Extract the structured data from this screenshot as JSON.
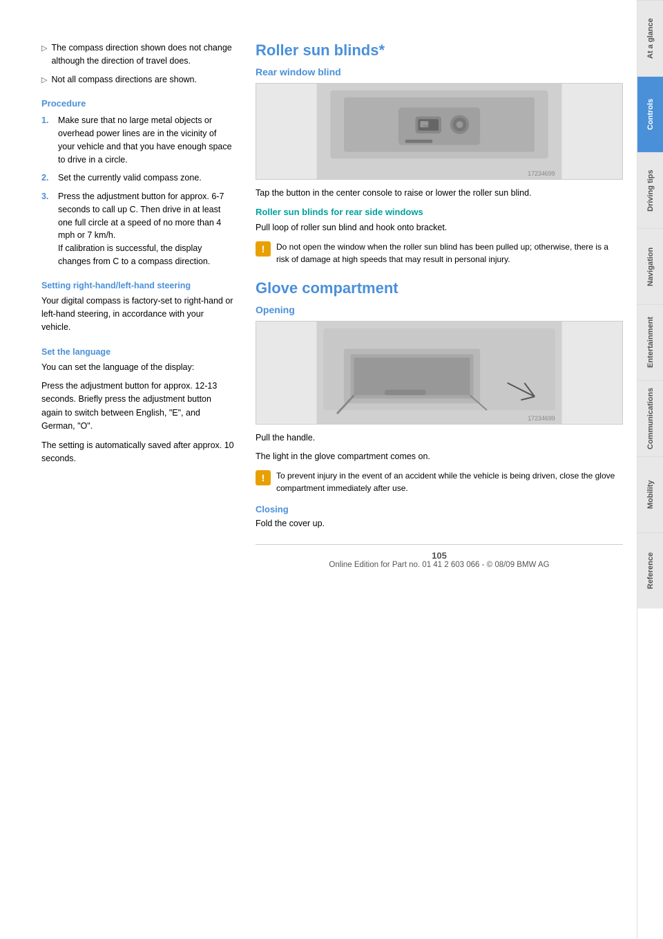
{
  "sidebar": {
    "tabs": [
      {
        "label": "At a glance",
        "active": false
      },
      {
        "label": "Controls",
        "active": true
      },
      {
        "label": "Driving tips",
        "active": false
      },
      {
        "label": "Navigation",
        "active": false
      },
      {
        "label": "Entertainment",
        "active": false
      },
      {
        "label": "Communications",
        "active": false
      },
      {
        "label": "Mobility",
        "active": false
      },
      {
        "label": "Reference",
        "active": false
      }
    ]
  },
  "left_column": {
    "bullets": [
      "The compass direction shown does not change although the direction of travel does.",
      "Not all compass directions are shown."
    ],
    "procedure_heading": "Procedure",
    "procedure_steps": [
      "Make sure that no large metal objects or overhead power lines are in the vicinity of your vehicle and that you have enough space to drive in a circle.",
      "Set the currently valid compass zone.",
      "Press the adjustment button for approx. 6-7 seconds to call up C. Then drive in at least one full circle at a speed of no more than 4 mph or 7 km/h.\nIf calibration is successful, the display changes from C to a compass direction."
    ],
    "setting_heading": "Setting right-hand/left-hand steering",
    "setting_text": "Your digital compass is factory-set to right-hand or left-hand steering, in accordance with your vehicle.",
    "language_heading": "Set the language",
    "language_text1": "You can set the language of the display:",
    "language_text2": "Press the adjustment button for approx. 12-13 seconds. Briefly press the adjustment button again to switch between English, \"E\", and German, \"O\".",
    "language_text3": "The setting is automatically saved after approx. 10 seconds."
  },
  "right_column": {
    "roller_title": "Roller sun blinds*",
    "rear_window_subtitle": "Rear window blind",
    "rear_window_desc": "Tap the button in the center console to raise or lower the roller sun blind.",
    "roller_side_subtitle": "Roller sun blinds for rear side windows",
    "roller_side_desc": "Pull loop of roller sun blind and hook onto bracket.",
    "roller_warning": "Do not open the window when the roller sun blind has been pulled up; otherwise, there is a risk of damage at high speeds that may result in personal injury.",
    "glove_title": "Glove compartment",
    "opening_subtitle": "Opening",
    "opening_desc1": "Pull the handle.",
    "opening_desc2": "The light in the glove compartment comes on.",
    "opening_warning": "To prevent injury in the event of an accident while the vehicle is being driven, close the glove compartment immediately after use.",
    "closing_subtitle": "Closing",
    "closing_desc": "Fold the cover up.",
    "rear_img_code": "17234699",
    "opening_img_code": "17234699"
  },
  "footer": {
    "page_number": "105",
    "copyright": "Online Edition for Part no. 01 41 2 603 066 - © 08/09 BMW AG"
  }
}
